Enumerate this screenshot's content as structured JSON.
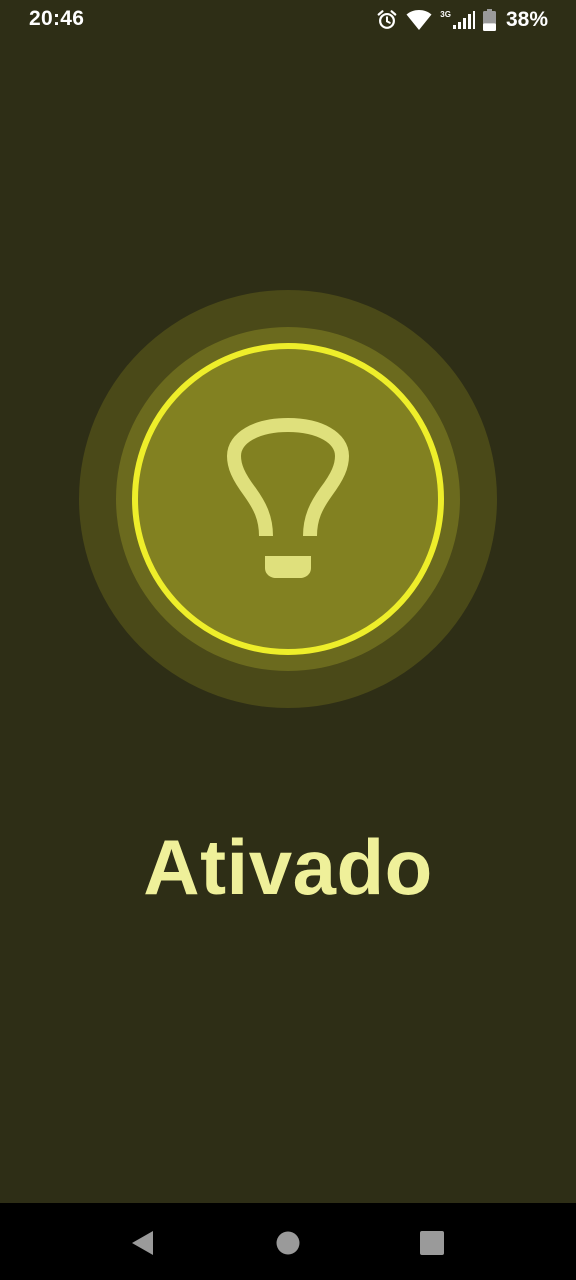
{
  "status_bar": {
    "time": "20:46",
    "network_type": "3G",
    "battery_percent": "38%",
    "battery_level": 0.38,
    "icons": [
      "alarm-icon",
      "wifi-icon",
      "cellular-signal-icon",
      "battery-icon"
    ]
  },
  "flashlight": {
    "state_label": "Ativado",
    "is_on": true,
    "icon": "lightbulb-icon"
  },
  "navigation_bar": {
    "buttons": [
      "back-icon",
      "home-icon",
      "recents-icon"
    ]
  },
  "colors": {
    "background": "#2e2e16",
    "halo_outer": "#4a4918",
    "halo_inner": "#6b6a1e",
    "button_fill": "#828121",
    "button_ring": "#eeee2a",
    "bulb": "#dfe07c",
    "label": "#eff09a",
    "nav_bar": "#000000"
  }
}
